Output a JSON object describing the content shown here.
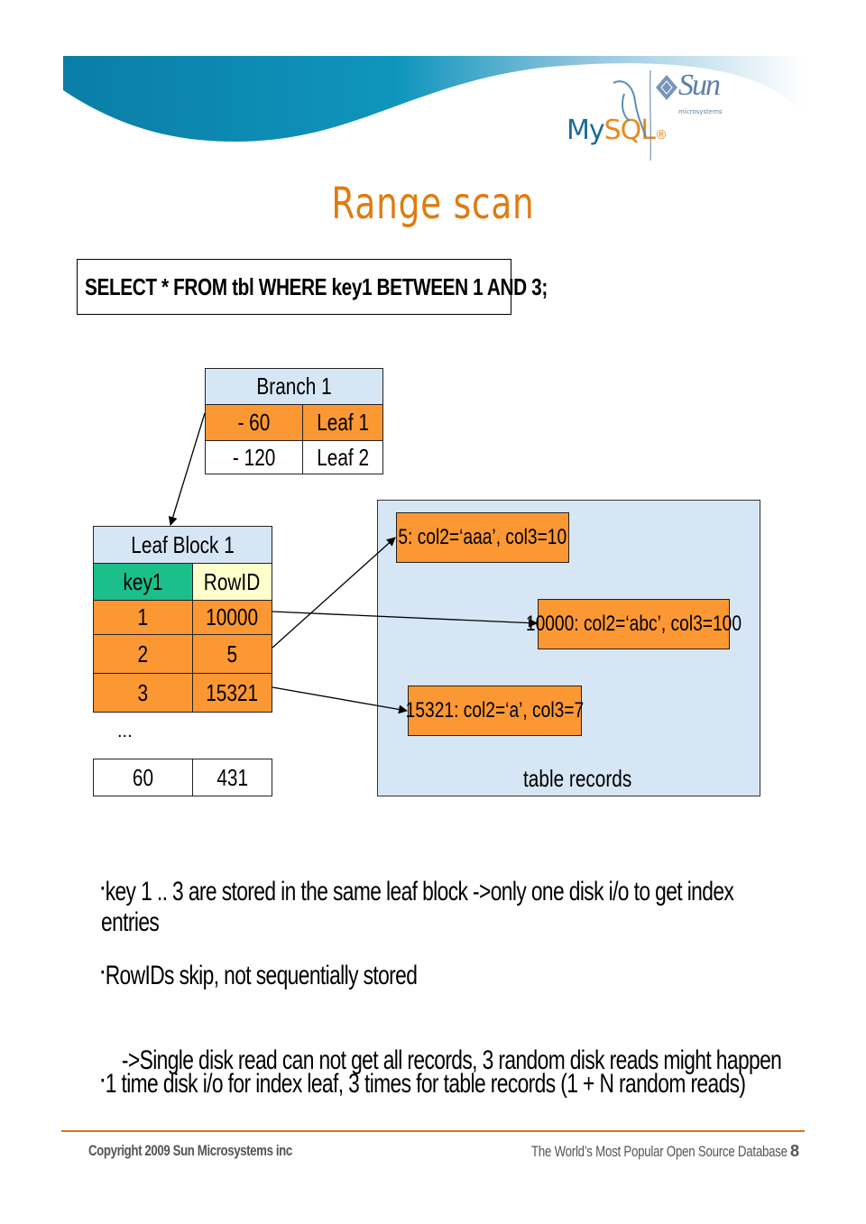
{
  "header": {
    "logos": {
      "mysql": {
        "part1": "My",
        "part2": "SQL",
        "mark": "®"
      },
      "sun": {
        "name": "Sun",
        "sub": "microsystems"
      }
    },
    "colors": {
      "banner_dark": "#0a7ea6",
      "banner_light": "#5fb5d4",
      "title": "#e07b12"
    }
  },
  "slide": {
    "title": "Range scan",
    "sql": "SELECT * FROM tbl WHERE key1 BETWEEN 1 AND 3;"
  },
  "branch": {
    "title": "Branch 1",
    "rows": [
      {
        "key": "- 60",
        "ptr": "Leaf 1",
        "highlight": true
      },
      {
        "key": "- 120",
        "ptr": "Leaf 2",
        "highlight": false
      }
    ]
  },
  "leaf": {
    "title": "Leaf Block 1",
    "headers": {
      "key": "key1",
      "rowid": "RowID"
    },
    "rows": [
      {
        "key": "1",
        "rowid": "10000"
      },
      {
        "key": "2",
        "rowid": "5"
      },
      {
        "key": "3",
        "rowid": "15321"
      }
    ],
    "ellipsis": "...",
    "last_row": {
      "key": "60",
      "rowid": "431"
    }
  },
  "table_records": {
    "label": "table records",
    "records": [
      "5: col2=‘aaa’, col3=10",
      "10000: col2=‘abc’, col3=100",
      "15321: col2=‘a’, col3=7"
    ]
  },
  "bullets": [
    {
      "marker": "▪",
      "text": "key 1 .. 3 are stored in the same leaf block  ->only one disk i/o to get index",
      "continuation": "entries"
    },
    {
      "marker": "▪",
      "text": "RowIDs skip, not sequentially stored"
    },
    {
      "marker": "",
      "text": "  ->Single disk read can not get all records, 3 random disk reads might happen"
    },
    {
      "marker": "▪",
      "text": "1 time disk i/o for index leaf, 3 times for table records (1 + N random reads)"
    }
  ],
  "footer": {
    "copyright": "Copyright 2009 Sun Microsystems inc",
    "tagline": "The World’s Most Popular Open Source Database",
    "page": "8"
  }
}
